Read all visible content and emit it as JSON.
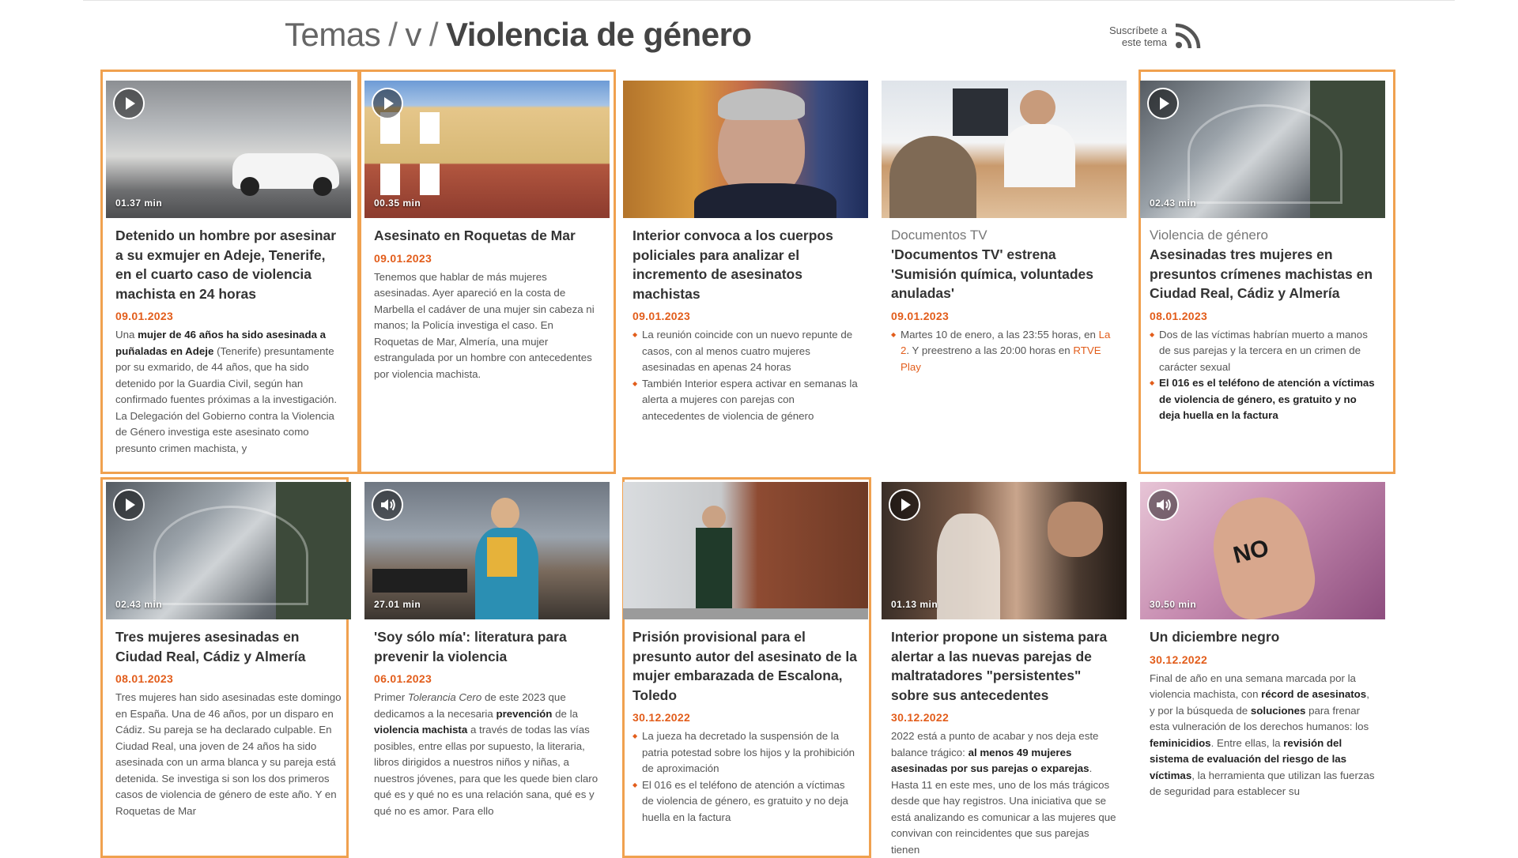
{
  "header": {
    "crumb_root": "Temas",
    "crumb_letter": "v",
    "crumb_current": "Violencia de género",
    "rss_line1": "Suscríbete a",
    "rss_line2": "este tema"
  },
  "cards": [
    {
      "media": "play",
      "duration": "01.37 min",
      "title": "Detenido un hombre por asesinar a su exmujer en Adeje, Tenerife, en el cuarto caso de violencia machista en 24 horas",
      "date": "09.01.2023",
      "text_a": "Una ",
      "text_b": "mujer de 46 años ha sido asesinada a puñaladas en Adeje",
      "text_c": " (Tenerife) presuntamente por su exmarido, de 44 años, que ha sido detenido por la Guardia Civil, según han confirmado fuentes próximas a la investigación. La Delegación del Gobierno contra la Violencia de Género investiga este asesinato como presunto crimen machista, y"
    },
    {
      "media": "play",
      "duration": "00.35 min",
      "title": "Asesinato en Roquetas de Mar",
      "date": "09.01.2023",
      "text": "Tenemos que hablar de más mujeres asesinadas. Ayer apareció en la costa de Marbella el cadáver de una mujer sin cabeza ni manos; la Policía investiga el caso. En Roquetas de Mar, Almería, una mujer estrangulada por un hombre con antecedentes por violencia machista."
    },
    {
      "media": "none",
      "title": "Interior convoca a los cuerpos policiales para analizar el incremento de asesinatos machistas",
      "date": "09.01.2023",
      "bullet1": "La reunión coincide con un nuevo repunte de casos, con al menos cuatro mujeres asesinadas en apenas 24 horas",
      "bullet2": "También Interior espera activar en semanas la alerta a mujeres con parejas con antecedentes de violencia de género"
    },
    {
      "media": "none",
      "kicker": "Documentos TV",
      "title": "'Documentos TV' estrena 'Sumisión química, voluntades anuladas'",
      "date": "09.01.2023",
      "bullet1_a": "Martes 10 de enero, a las 23:55 horas, en ",
      "bullet1_link1": "La 2",
      "bullet1_b": ". Y preestreno a las 20:00 horas en ",
      "bullet1_link2": "RTVE Play"
    },
    {
      "media": "play",
      "duration": "02.43 min",
      "kicker": "Violencia de género",
      "title": "Asesinadas tres mujeres en presuntos crímenes machistas en Ciudad Real, Cádiz y Almería",
      "date": "08.01.2023",
      "bullet1": "Dos de las víctimas habrían muerto a manos de sus parejas y la tercera en un crimen de carácter sexual",
      "bullet2": "El 016 es el teléfono de atención a víctimas de violencia de género, es gratuito y no deja huella en la factura"
    },
    {
      "media": "play",
      "duration": "02.43 min",
      "title": "Tres mujeres asesinadas en Ciudad Real, Cádiz y Almería",
      "date": "08.01.2023",
      "text": "Tres mujeres han sido asesinadas este domingo en España. Una de 46 años, por un disparo en Cádiz. Su pareja se ha declarado culpable. En Ciudad Real, una joven de 24 años ha sido asesinada con un arma blanca y su pareja está detenida. Se investiga si son los dos primeros casos de violencia de género de este año. Y en Roquetas de Mar"
    },
    {
      "media": "audio",
      "duration": "27.01 min",
      "title": "'Soy sólo mía': literatura para prevenir la violencia",
      "date": "06.01.2023",
      "text_a": "Primer ",
      "text_i": "Tolerancia Cero",
      "text_b": " de este 2023 que dedicamos a la necesaria ",
      "text_bold1": "prevención",
      "text_c": " de la ",
      "text_bold2": "violencia machista",
      "text_d": " a través de todas las vías posibles, entre ellas por supuesto, la literaria, libros dirigidos a nuestros niños y niñas, a nuestros jóvenes, para que les quede bien claro qué es y qué no es una relación sana, qué es y qué no es amor. Para ello"
    },
    {
      "media": "none",
      "title": "Prisión provisional para el presunto autor del asesinato de la mujer embarazada de Escalona, Toledo",
      "date": "30.12.2022",
      "bullet1": "La jueza ha decretado la suspensión de la patria potestad sobre los hijos y la prohibición de aproximación",
      "bullet2": "El 016 es el teléfono de atención a víctimas de violencia de género, es gratuito y no deja huella en la factura"
    },
    {
      "media": "play",
      "duration": "01.13 min",
      "title": "Interior propone un sistema para alertar a las nuevas parejas de maltratadores \"persistentes\" sobre sus antecedentes",
      "date": "30.12.2022",
      "text_a": "2022 está a punto de acabar y nos deja este balance trágico: ",
      "text_b": "al menos 49 mujeres asesinadas por sus parejas o exparejas",
      "text_c": ". Hasta 11 en este mes, uno de los más trágicos desde que hay registros. Una iniciativa que se está analizando es comunicar a las mujeres que convivan con reincidentes que sus parejas tienen"
    },
    {
      "media": "audio",
      "duration": "30.50 min",
      "title": "Un diciembre negro",
      "date": "30.12.2022",
      "text_a": "Final de año en una semana marcada por la violencia machista, con ",
      "text_b": "récord de asesinatos",
      "text_c": ", y por la búsqueda de ",
      "text_d": "soluciones",
      "text_e": " para frenar esta vulneración de los derechos humanos: los ",
      "text_f": "feminicidios",
      "text_g": ". Entre ellas, la ",
      "text_h": "revisión del sistema de evaluación del riesgo de las víctimas",
      "text_i": ", la herramienta que utilizan las fuerzas de seguridad para establecer su",
      "thumb_word": "NO"
    }
  ],
  "colors": {
    "accent": "#e25d1b",
    "highlight_border": "#f0a14f"
  }
}
